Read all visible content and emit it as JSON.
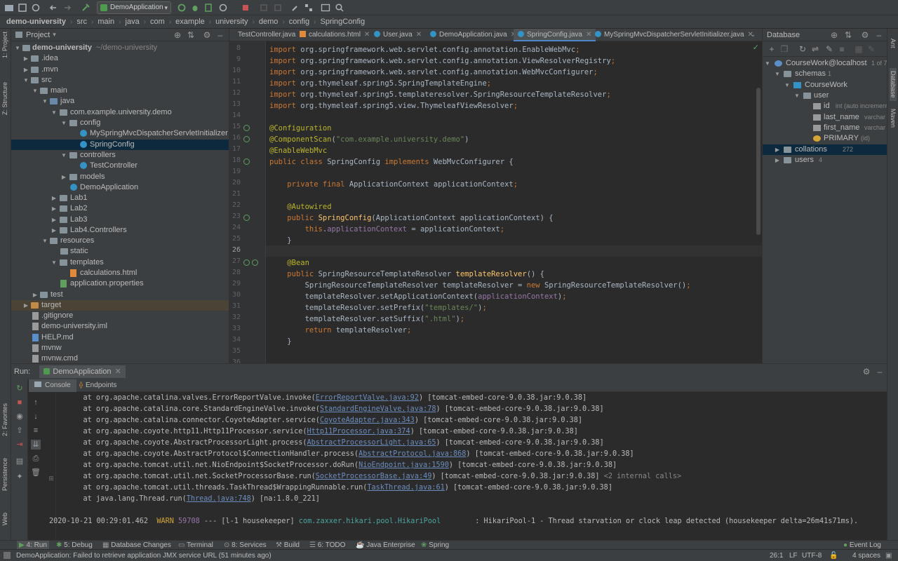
{
  "toolbar": {
    "run_config": "DemoApplication"
  },
  "breadcrumb": [
    "demo-university",
    "src",
    "main",
    "java",
    "com",
    "example",
    "university",
    "demo",
    "config",
    "SpringConfig"
  ],
  "left_strip": {
    "project": "1: Project",
    "structure": "Z: Structure",
    "favorites": "2: Favorites",
    "persistence": "Persistence",
    "web": "Web"
  },
  "project_panel": {
    "title": "Project",
    "tree": [
      {
        "label": "demo-university",
        "suffix": "~/demo-university"
      },
      {
        "label": ".idea"
      },
      {
        "label": ".mvn"
      },
      {
        "label": "src"
      },
      {
        "label": "main"
      },
      {
        "label": "java"
      },
      {
        "label": "com.example.university.demo"
      },
      {
        "label": "config"
      },
      {
        "label": "MySpringMvcDispatcherServletInitializer"
      },
      {
        "label": "SpringConfig"
      },
      {
        "label": "controllers"
      },
      {
        "label": "TestController"
      },
      {
        "label": "models"
      },
      {
        "label": "DemoApplication"
      },
      {
        "label": "Lab1"
      },
      {
        "label": "Lab2"
      },
      {
        "label": "Lab3"
      },
      {
        "label": "Lab4.Controllers"
      },
      {
        "label": "resources"
      },
      {
        "label": "static"
      },
      {
        "label": "templates"
      },
      {
        "label": "calculations.html"
      },
      {
        "label": "application.properties"
      },
      {
        "label": "test"
      },
      {
        "label": "target"
      },
      {
        "label": ".gitignore"
      },
      {
        "label": "demo-university.iml"
      },
      {
        "label": "HELP.md"
      },
      {
        "label": "mvnw"
      },
      {
        "label": "mvnw.cmd"
      }
    ]
  },
  "editor_tabs": [
    "TestController.java",
    "calculations.html",
    "User.java",
    "DemoApplication.java",
    "SpringConfig.java",
    "MySpringMvcDispatcherServletInitializer.java"
  ],
  "editor": {
    "line_numbers": [
      "8",
      "9",
      "10",
      "11",
      "12",
      "13",
      "14",
      "15",
      "16",
      "17",
      "18",
      "19",
      "20",
      "21",
      "22",
      "23",
      "24",
      "25",
      "26",
      "27",
      "28",
      "29",
      "30",
      "31",
      "32",
      "33",
      "34",
      "35",
      "36"
    ],
    "lines": [
      "import org.springframework.web.servlet.config.annotation.EnableWebMvc;",
      "import org.springframework.web.servlet.config.annotation.ViewResolverRegistry;",
      "import org.springframework.web.servlet.config.annotation.WebMvcConfigurer;",
      "import org.thymeleaf.spring5.SpringTemplateEngine;",
      "import org.thymeleaf.spring5.templateresolver.SpringResourceTemplateResolver;",
      "import org.thymeleaf.spring5.view.ThymeleafViewResolver;",
      "",
      "@Configuration",
      "@ComponentScan(\"com.example.university.demo\")",
      "@EnableWebMvc",
      "public class SpringConfig implements WebMvcConfigurer {",
      "",
      "    private final ApplicationContext applicationContext;",
      "",
      "    @Autowired",
      "    public SpringConfig(ApplicationContext applicationContext) {",
      "        this.applicationContext = applicationContext;",
      "    }",
      "",
      "    @Bean",
      "    public SpringResourceTemplateResolver templateResolver() {",
      "        SpringResourceTemplateResolver templateResolver = new SpringResourceTemplateResolver();",
      "        templateResolver.setApplicationContext(applicationContext);",
      "        templateResolver.setPrefix(\"templates/\");",
      "        templateResolver.setSuffix(\".html\");",
      "        return templateResolver;",
      "    }",
      "",
      ""
    ]
  },
  "database_panel": {
    "title": "Database",
    "rows": [
      {
        "label": "CourseWork@localhost",
        "extra": "1 of 7"
      },
      {
        "label": "schemas",
        "extra": "1"
      },
      {
        "label": "CourseWork",
        "extra": ""
      },
      {
        "label": "user",
        "extra": ""
      },
      {
        "label": "id",
        "extra": "int (auto increment)"
      },
      {
        "label": "last_name",
        "extra": "varchar"
      },
      {
        "label": "first_name",
        "extra": "varchar"
      },
      {
        "label": "PRIMARY",
        "extra": "(id)"
      },
      {
        "label": "collations",
        "extra": "272"
      },
      {
        "label": "users",
        "extra": "4"
      }
    ]
  },
  "right_strip": {
    "ant": "Ant",
    "database": "Database",
    "maven": "Maven"
  },
  "run_panel": {
    "label": "Run:",
    "config": "DemoApplication",
    "tabs": [
      "Console",
      "Endpoints"
    ],
    "stack": [
      {
        "pre": "    at org.apache.catalina.valves.ErrorReportValve.invoke(",
        "link": "ErrorReportValve.java:92",
        "post": ") [tomcat-embed-core-9.0.38.jar:9.0.38]"
      },
      {
        "pre": "    at org.apache.catalina.core.StandardEngineValve.invoke(",
        "link": "StandardEngineValve.java:78",
        "post": ") [tomcat-embed-core-9.0.38.jar:9.0.38]"
      },
      {
        "pre": "    at org.apache.catalina.connector.CoyoteAdapter.service(",
        "link": "CoyoteAdapter.java:343",
        "post": ") [tomcat-embed-core-9.0.38.jar:9.0.38]"
      },
      {
        "pre": "    at org.apache.coyote.http11.Http11Processor.service(",
        "link": "Http11Processor.java:374",
        "post": ") [tomcat-embed-core-9.0.38.jar:9.0.38]"
      },
      {
        "pre": "    at org.apache.coyote.AbstractProcessorLight.process(",
        "link": "AbstractProcessorLight.java:65",
        "post": ") [tomcat-embed-core-9.0.38.jar:9.0.38]"
      },
      {
        "pre": "    at org.apache.coyote.AbstractProtocol$ConnectionHandler.process(",
        "link": "AbstractProtocol.java:868",
        "post": ") [tomcat-embed-core-9.0.38.jar:9.0.38]"
      },
      {
        "pre": "    at org.apache.tomcat.util.net.NioEndpoint$SocketProcessor.doRun(",
        "link": "NioEndpoint.java:1590",
        "post": ") [tomcat-embed-core-9.0.38.jar:9.0.38]"
      },
      {
        "pre": "    at org.apache.tomcat.util.net.SocketProcessorBase.run(",
        "link": "SocketProcessorBase.java:49",
        "post": ") [tomcat-embed-core-9.0.38.jar:9.0.38]",
        "extra": " <2 internal calls>"
      },
      {
        "pre": "    at org.apache.tomcat.util.threads.TaskThread$WrappingRunnable.run(",
        "link": "TaskThread.java:61",
        "post": ") [tomcat-embed-core-9.0.38.jar:9.0.38]"
      },
      {
        "pre": "    at java.lang.Thread.run(",
        "link": "Thread.java:748",
        "post": ") [na:1.8.0_221]"
      }
    ],
    "log": {
      "timestamp": "2020-10-21 00:29:01.462",
      "level": "WARN",
      "pid": "59708",
      "mid": " --- [l-1 housekeeper] ",
      "logger": "com.zaxxer.hikari.pool.HikariPool",
      "message": ": HikariPool-1 - Thread starvation or clock leap detected (housekeeper delta=26m41s71ms)."
    }
  },
  "bottom_bar": {
    "items": [
      "4: Run",
      "5: Debug",
      "Database Changes",
      "Terminal",
      "8: Services",
      "Build",
      "6: TODO",
      "Java Enterprise",
      "Spring"
    ],
    "event_log": "Event Log"
  },
  "status_bar": {
    "message": "DemoApplication: Failed to retrieve application JMX service URL (51 minutes ago)",
    "position": "26:1",
    "line_sep": "LF",
    "encoding": "UTF-8",
    "indent": "4 spaces"
  }
}
